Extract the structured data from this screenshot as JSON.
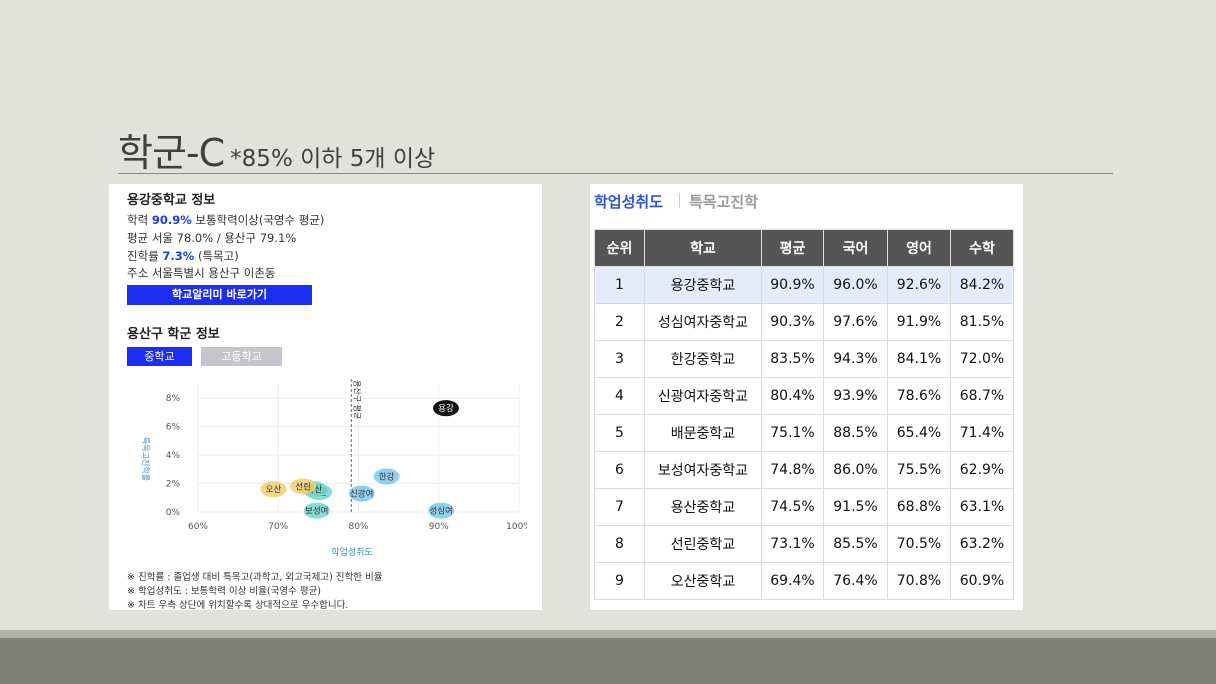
{
  "slide": {
    "title": "학군-C",
    "note": "*85% 이하 5개 이상"
  },
  "left_panel": {
    "heading": "용강중학교 정보",
    "academic": {
      "label": "학력",
      "value": "90.9%",
      "desc": "보통학력이상(국영수 평균)"
    },
    "average": "평균 서울 78.0% / 용산구 79.1%",
    "advance": {
      "label": "진학률",
      "value": "7.3%",
      "desc": "(특목고)"
    },
    "address": "주소 서울특별시 용산구 이촌동",
    "link_button": "학교알리미 바로가기",
    "district_heading": "용산구 학군 정보",
    "tabs": {
      "middle": "중학교",
      "high": "고등학교"
    },
    "footnotes": [
      "※ 진학률 : 졸업생 대비 특목고(과학고, 외고국제고) 진학한 비율",
      "※ 학업성취도 : 보통학력 이상 비율(국영수 평균)",
      "※ 차트 우측 상단에 위치할수록 상대적으로 우수합니다."
    ]
  },
  "chart_data": {
    "type": "scatter",
    "xlabel": "학업성취도",
    "ylabel": "특목고진학률",
    "xlim": [
      60,
      100
    ],
    "ylim": [
      0,
      9
    ],
    "x_ticks": [
      "60%",
      "70%",
      "80%",
      "90%",
      "100%"
    ],
    "y_ticks": [
      "0%",
      "2%",
      "4%",
      "6%",
      "8%"
    ],
    "reference_line": {
      "x": 79.1,
      "label": "용산구 평균"
    },
    "points": [
      {
        "label": "용강",
        "x": 90.9,
        "y": 7.3,
        "color": "#111111"
      },
      {
        "label": "한강",
        "x": 83.5,
        "y": 2.5,
        "color": "#7ec8ea"
      },
      {
        "label": "신광여",
        "x": 80.4,
        "y": 1.3,
        "color": "#7ec8ea"
      },
      {
        "label": "성심여",
        "x": 90.3,
        "y": 0.1,
        "color": "#7ec8ea"
      },
      {
        "label": "보성여",
        "x": 74.8,
        "y": 0.1,
        "color": "#6fd8cf"
      },
      {
        "label": "배문",
        "x": 75.1,
        "y": 1.4,
        "color": "#6fd8cf"
      },
      {
        "label": "용산",
        "x": 74.5,
        "y": 1.6,
        "color": "#6fd8cf"
      },
      {
        "label": "선린",
        "x": 73.1,
        "y": 1.8,
        "color": "#f4cf6e"
      },
      {
        "label": "오산",
        "x": 69.4,
        "y": 1.6,
        "color": "#f4cf6e"
      }
    ]
  },
  "right_panel": {
    "tabs": [
      "학업성취도",
      "특목고진학"
    ],
    "columns": [
      "순위",
      "학교",
      "평균",
      "국어",
      "영어",
      "수학"
    ],
    "rows": [
      [
        "1",
        "용강중학교",
        "90.9%",
        "96.0%",
        "92.6%",
        "84.2%"
      ],
      [
        "2",
        "성심여자중학교",
        "90.3%",
        "97.6%",
        "91.9%",
        "81.5%"
      ],
      [
        "3",
        "한강중학교",
        "83.5%",
        "94.3%",
        "84.1%",
        "72.0%"
      ],
      [
        "4",
        "신광여자중학교",
        "80.4%",
        "93.9%",
        "78.6%",
        "68.7%"
      ],
      [
        "5",
        "배문중학교",
        "75.1%",
        "88.5%",
        "65.4%",
        "71.4%"
      ],
      [
        "6",
        "보성여자중학교",
        "74.8%",
        "86.0%",
        "75.5%",
        "62.9%"
      ],
      [
        "7",
        "용산중학교",
        "74.5%",
        "91.5%",
        "68.8%",
        "63.1%"
      ],
      [
        "8",
        "선린중학교",
        "73.1%",
        "85.5%",
        "70.5%",
        "63.2%"
      ],
      [
        "9",
        "오산중학교",
        "69.4%",
        "76.4%",
        "70.8%",
        "60.9%"
      ]
    ]
  }
}
